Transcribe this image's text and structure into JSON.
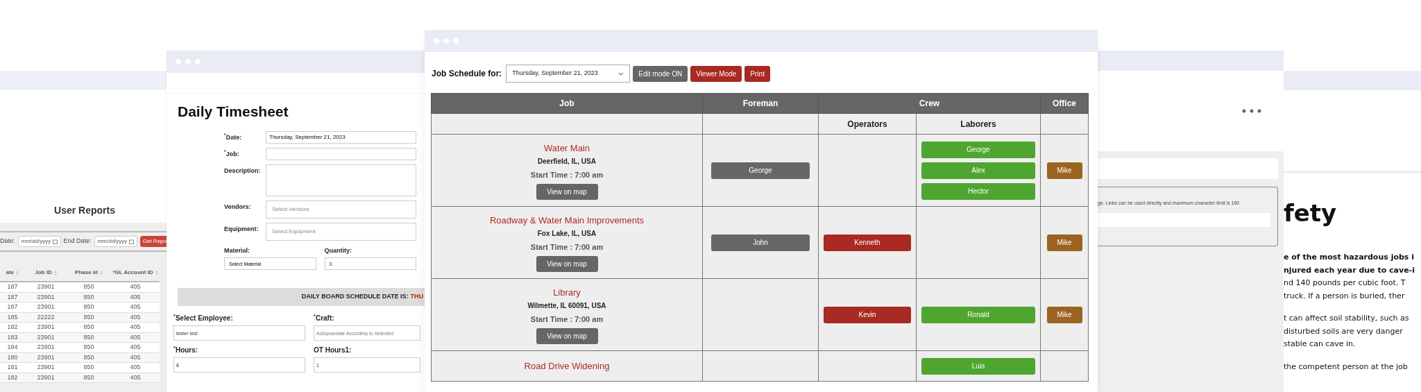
{
  "reports_window": {
    "title": "User Reports",
    "start_date_label": "Date:",
    "start_date_placeholder": "mm/dd/yyyy",
    "end_date_label": "End Date:",
    "end_date_placeholder": "mm/dd/yyyy",
    "report_button": "Get Repo",
    "columns": [
      "ate",
      "Job ID",
      "Phase Id",
      "*GL Account ID"
    ],
    "rows": [
      [
        "187",
        "23901",
        "850",
        "405"
      ],
      [
        "187",
        "23901",
        "850",
        "405"
      ],
      [
        "187",
        "23901",
        "850",
        "405"
      ],
      [
        "185",
        "22222",
        "850",
        "405"
      ],
      [
        "182",
        "23901",
        "850",
        "405"
      ],
      [
        "183",
        "23901",
        "850",
        "405"
      ],
      [
        "184",
        "23901",
        "850",
        "405"
      ],
      [
        "180",
        "23901",
        "850",
        "405"
      ],
      [
        "181",
        "23901",
        "850",
        "405"
      ],
      [
        "182",
        "23901",
        "850",
        "405"
      ]
    ]
  },
  "timesheet_window": {
    "title": "Daily Timesheet",
    "fields": [
      {
        "kind": "input",
        "label": "$^{*}$Date:",
        "value": "Thursday, September 21, 2023"
      },
      {
        "kind": "input",
        "label": "$^{*}$Job:"
      },
      {
        "kind": "textarea",
        "label": "Description:"
      },
      {
        "kind": "select",
        "label": "Vendors:",
        "placeholder": "Select Vendors"
      },
      {
        "kind": "select",
        "label": "Equipment:",
        "placeholder": "Select Equipment"
      }
    ],
    "material": {
      "label": "Material:",
      "value": "Select Material"
    },
    "quantity": {
      "label": "Quantity:",
      "value": "0"
    },
    "banner": {
      "label": "DAILY BOARD SCHEDULE DATE IS:",
      "value": "THU"
    },
    "employee": {
      "label": "$^{*}$Select Employee:",
      "value": "tester test"
    },
    "craft": {
      "label": "$^{*}$Craft:",
      "placeholder": "Autopopulate According to Selected"
    },
    "hours": {
      "label": "$^{*}$Hours:",
      "value": "8"
    },
    "ot_hours": {
      "label": "OT Hours1:",
      "value": "1"
    }
  },
  "schedule_window": {
    "label": "Job Schedule for:",
    "date": "Thursday, September 21, 2023",
    "buttons": [
      {
        "label": "Edit mode ON",
        "kind": "toggle"
      },
      {
        "label": "Viewer Mode",
        "kind": "action"
      },
      {
        "label": "Print",
        "kind": "action"
      }
    ],
    "columns": {
      "job": "Job",
      "foreman": "Foreman",
      "crew": "Crew",
      "operators": "Operators",
      "laborers": "Laborers",
      "office": "Office"
    },
    "rows": [
      {
        "name": "Water Main",
        "location": "Deerfield, IL, USA",
        "start": "Start Time : 7:00 am",
        "map_button": "View on map",
        "foreman": [
          "George"
        ],
        "operators": [],
        "laborers": [
          "George",
          "Alex",
          "Hector"
        ],
        "office": [
          "Mike"
        ]
      },
      {
        "name": "Roadway & Water Main Improvements",
        "location": "Fox Lake, IL, USA",
        "start": "Start Time : 7:00 am",
        "map_button": "View on map",
        "foreman": [
          "John"
        ],
        "operators": [
          "Kenneth"
        ],
        "laborers": [],
        "office": [
          "Mike"
        ]
      },
      {
        "name": "Library",
        "location": "Wilmette, IL 60091, USA",
        "start": "Start Time : 7:00 am",
        "map_button": "View on map",
        "foreman": [],
        "operators": [
          "Kevin"
        ],
        "laborers": [
          "Ronald"
        ],
        "office": [
          "Mike"
        ]
      },
      {
        "name": "Road Drive Widening",
        "foreman": [],
        "operators": [],
        "laborers": [
          "Luis"
        ],
        "office": []
      }
    ]
  },
  "notes_window": {
    "hint": "ge. Links can be used directly and maximum character limit is 160"
  },
  "safety_window": {
    "heading": "fety",
    "paragraphs": [
      [
        {
          "text": "e of the most hazardous jobs i",
          "bold": true
        },
        {
          "text": "njured each year due to cave-i",
          "bold": true
        },
        {
          "text": "nd 140 pounds per cubic foot. T",
          "bold": false
        },
        {
          "text": "truck. If a person is buried, ther",
          "bold": false
        }
      ],
      [
        {
          "text": "t can affect soil stability, such as",
          "bold": false
        },
        {
          "text": "disturbed soils are very danger",
          "bold": false
        },
        {
          "text": "stable can cave in.",
          "bold": false
        }
      ],
      [
        {
          "text": "the competent person at the job",
          "bold": false
        }
      ]
    ]
  }
}
